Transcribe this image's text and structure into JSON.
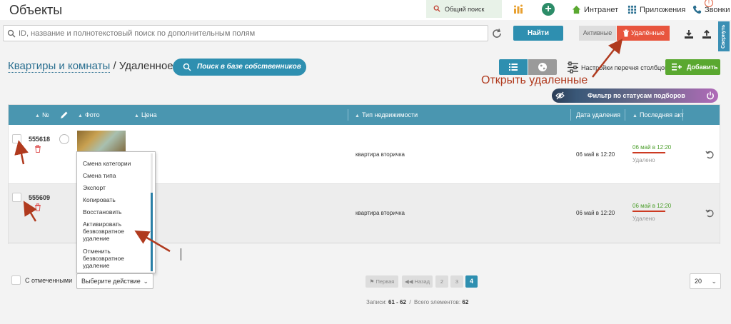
{
  "header": {
    "title": "Объекты",
    "global_search": "Общий поиск",
    "nav": {
      "intranet": "Интранет",
      "apps": "Приложения",
      "calls": "Звонки"
    },
    "notify_count": "!"
  },
  "search": {
    "placeholder": "ID, название и полнотекстовый поиск по дополнительным полям",
    "find_label": "Найти",
    "tab_active": "Активные",
    "tab_deleted": "Удалённые",
    "collapse_label": "Свернуть"
  },
  "toolbar": {
    "breadcrumb_link": "Квартиры и комнаты",
    "breadcrumb_current": " / Удаленное",
    "owner_search": "Поиск в базе собственников",
    "column_settings": "Настройки перечня столбцов",
    "add_label": "Добавить",
    "annotation": "Открыть удаленные",
    "filter_label": "Фильтр по статусам подборов"
  },
  "table": {
    "headers": {
      "num": "№",
      "photo": "Фото",
      "price": "Цена",
      "type": "Тип недвижимости",
      "deleted_date": "Дата удаления",
      "last_act": "Последняя акт"
    },
    "rows": [
      {
        "id": "555618",
        "type": "квартира вторичка",
        "deleted_date": "06 май в 12:20",
        "last": "06 май в 12:20",
        "status": "Удалено"
      },
      {
        "id": "555609",
        "type": "квартира вторичка",
        "deleted_date": "06 май в 12:20",
        "last": "06 май в 12:20",
        "status": "Удалено"
      }
    ]
  },
  "context_menu": {
    "items": [
      "Смена категории",
      "Смена типа",
      "Экспорт",
      "Копировать",
      "Восстановить",
      "Активировать безвозвратное удаление",
      "Отменить безвозвратное удаление"
    ]
  },
  "footer": {
    "with_selected": "С отмеченными",
    "action_select": "Выберите действие",
    "pages": {
      "first": "Первая",
      "back": "Назад",
      "p2": "2",
      "p3": "3",
      "p4": "4"
    },
    "records_label": "Записи:",
    "records_range": "61 - 62",
    "total_label": "Всего элементов:",
    "total": "62",
    "per_page": "20"
  },
  "colors": {
    "accent": "#2e8fb0",
    "deleted": "#e8553e",
    "add": "#5aa830",
    "arrow": "#b03a1e"
  }
}
